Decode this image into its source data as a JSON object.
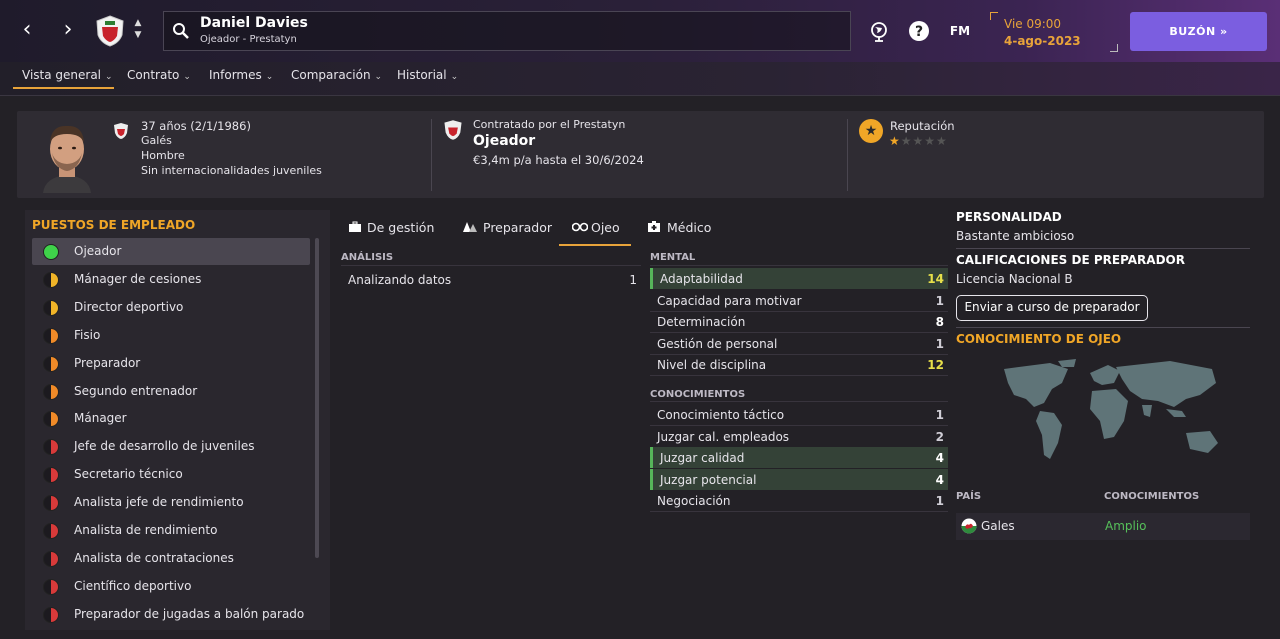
{
  "header": {
    "person_name": "Daniel Davies",
    "person_sub": "Ojeador - Prestatyn",
    "fm_label": "FM",
    "date_day": "Vie 09:00",
    "date_date": "4-ago-2023",
    "buzon_label": "BUZÓN »"
  },
  "nav": {
    "items": [
      "Vista general",
      "Contrato",
      "Informes",
      "Comparación",
      "Historial"
    ]
  },
  "profile": {
    "age": "37 años (2/1/1986)",
    "nationality": "Galés",
    "gender": "Hombre",
    "youth_caps": "Sin internacionalidades juveniles",
    "contracted_by": "Contratado por el Prestatyn",
    "role": "Ojeador",
    "salary": "€3,4m p/a hasta el 30/6/2024",
    "reputation_label": "Reputación",
    "reputation_stars": 0.5
  },
  "left_panel": {
    "title": "PUESTOS DE EMPLEADO",
    "roles": [
      {
        "label": "Ojeador",
        "dot": "green"
      },
      {
        "label": "Mánager de cesiones",
        "dot": "yellow"
      },
      {
        "label": "Director deportivo",
        "dot": "yellow"
      },
      {
        "label": "Fisio",
        "dot": "orange"
      },
      {
        "label": "Preparador",
        "dot": "orange"
      },
      {
        "label": "Segundo entrenador",
        "dot": "orange"
      },
      {
        "label": "Mánager",
        "dot": "orange"
      },
      {
        "label": "Jefe de desarrollo de juveniles",
        "dot": "red"
      },
      {
        "label": "Secretario técnico",
        "dot": "red"
      },
      {
        "label": "Analista jefe de rendimiento",
        "dot": "red"
      },
      {
        "label": "Analista de rendimiento",
        "dot": "red"
      },
      {
        "label": "Analista de contrataciones",
        "dot": "red"
      },
      {
        "label": "Científico deportivo",
        "dot": "red"
      },
      {
        "label": "Preparador de jugadas a balón parado",
        "dot": "red"
      }
    ]
  },
  "tabs": [
    "De gestión",
    "Preparador",
    "Ojeo",
    "Médico"
  ],
  "analisis": {
    "head": "ANÁLISIS",
    "rows": [
      {
        "name": "Analizando datos",
        "value": "1"
      }
    ]
  },
  "mental": {
    "head": "MENTAL",
    "rows": [
      {
        "name": "Adaptabilidad",
        "value": "14",
        "hl": true
      },
      {
        "name": "Capacidad para motivar",
        "value": "1",
        "hl": false
      },
      {
        "name": "Determinación",
        "value": "8",
        "hl": false
      },
      {
        "name": "Gestión de personal",
        "value": "1",
        "hl": false
      },
      {
        "name": "Nivel de disciplina",
        "value": "12",
        "hl": false
      }
    ]
  },
  "conocimientos": {
    "head": "CONOCIMIENTOS",
    "rows": [
      {
        "name": "Conocimiento táctico",
        "value": "1",
        "hl": false
      },
      {
        "name": "Juzgar cal. empleados",
        "value": "2",
        "hl": false
      },
      {
        "name": "Juzgar calidad",
        "value": "4",
        "hl": true
      },
      {
        "name": "Juzgar potencial",
        "value": "4",
        "hl": true
      },
      {
        "name": "Negociación",
        "value": "1",
        "hl": false
      }
    ]
  },
  "right": {
    "personality_head": "PERSONALIDAD",
    "personality": "Bastante ambicioso",
    "coach_head": "CALIFICACIONES DE PREPARADOR",
    "coach_license": "Licencia Nacional B",
    "course_button": "Enviar a curso de preparador",
    "scout_head": "CONOCIMIENTO DE OJEO",
    "col_country": "PAÍS",
    "col_knowledge": "CONOCIMIENTOS",
    "country": "Gales",
    "knowledge": "Amplio"
  },
  "colors": {
    "accent": "#f0a627",
    "buzon": "#7b5ee0",
    "highlight_green": "#56b55a",
    "value_yellow": "#e8e04a"
  }
}
